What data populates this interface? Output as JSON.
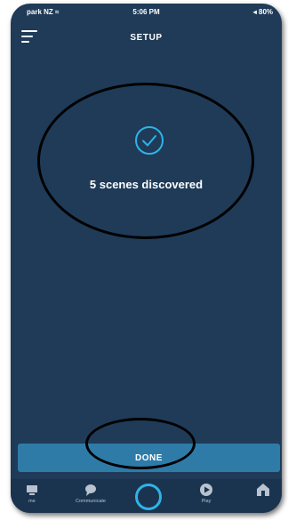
{
  "status_bar": {
    "carrier": "park NZ ≈",
    "time": "5:06 PM",
    "battery": "◂ 80%"
  },
  "header": {
    "title": "SETUP"
  },
  "main": {
    "message": "5 scenes discovered"
  },
  "actions": {
    "done_label": "DONE"
  },
  "tab_bar": {
    "items": [
      {
        "label": "me",
        "icon": "home-icon"
      },
      {
        "label": "Communicate",
        "icon": "chat-icon"
      },
      {
        "label": "",
        "icon": "alexa-icon"
      },
      {
        "label": "Play",
        "icon": "play-icon"
      },
      {
        "label": "",
        "icon": "devices-icon"
      }
    ]
  },
  "colors": {
    "background": "#1f3b58",
    "accent": "#2e7ba8",
    "alexa_ring": "#2fb3e8"
  }
}
